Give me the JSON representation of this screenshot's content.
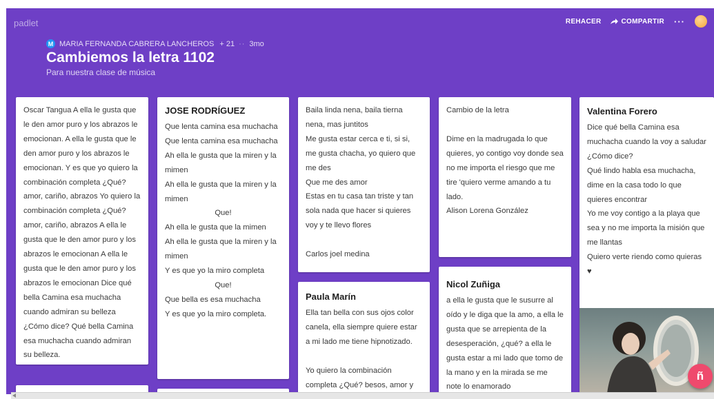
{
  "app": {
    "logo": "padlet"
  },
  "header": {
    "author_initial": "M",
    "author": "MARIA FERNANDA CABRERA LANCHEROS",
    "plus": "+ 21",
    "age": "3mo",
    "title": "Cambiemos la letra 1102",
    "subtitle": "Para nuestra clase de música"
  },
  "toolbar": {
    "redo": "REHACER",
    "share": "COMPARTIR",
    "more": "···"
  },
  "posts": {
    "oscar": {
      "body": "Oscar Tangua A ella le gusta que le den amor puro y los abrazos le emocionan. A ella le gusta que le den amor puro y los abrazos le emocionan. Y es que yo quiero la combinación completa ¿Qué? amor, cariño, abrazos Yo quiero la combinación completa ¿Qué? amor, cariño, abrazos A ella le gusta que le den amor puro y los abrazos le emocionan A ella le gusta que le den amor puro y los abrazos le emocionan Dice qué bella Camina esa muchacha cuando admiran su belleza ¿Cómo dice? Qué bella Camina esa muchacha cuando admiran su belleza."
    },
    "jose": {
      "title": "JOSE RODRÍGUEZ",
      "lines1": "Que lenta camina esa muchacha\nQue lenta camina esa muchacha\nAh ella le gusta que la miren y la mimen\nAh ella le gusta que la miren y la mimen",
      "que1": "Que!",
      "lines2": "Ah ella le gusta que la mimen\nAh ella le gusta que la miren y la mimen\nY es que yo la miro completa",
      "que2": "Que!",
      "lines3": "Que bella es esa muchacha\nY es que yo la miro completa."
    },
    "carlos": {
      "body": "Baila linda nena, baila tierna nena, mas juntitos\nMe gusta estar cerca e ti, si si, me gusta chacha, yo quiero que me des\nQue me des amor\nEstas en tu casa tan triste y tan sola nada que hacer si quieres voy y te llevo flores",
      "signature": "Carlos joel medina"
    },
    "paula": {
      "title": "Paula Marín",
      "body1": "Ella tan bella con sus ojos color canela, ella siempre quiere estar a mi lado me tiene hipnotizado.",
      "body2": " Yo quiero la combinación completa ¿Qué? besos, amor y"
    },
    "alison": {
      "title": "Cambio de la letra",
      "body": "Dime en la madrugada lo que quieres, yo contigo voy donde sea no me importa el riesgo que me tire 'quiero verme amando a tu lado.\nAlison Lorena González"
    },
    "nicol": {
      "title": "Nicol Zuñiga",
      "body": "a ella le gusta que le susurre al oído y le diga que la amo, a ella le gusta que se arrepienta de la desesperación, ¿qué? a ella le gusta estar a mi lado que tomo de la mano y en la mirada se me note lo enamorado"
    },
    "valentina": {
      "title": "Valentina Forero",
      "body": "Dice qué bella Camina esa muchacha cuando la voy a saludar ¿Cómo dice?\nQué lindo habla esa muchacha, dime en la casa todo lo que quieres encontrar\nYo me voy contigo a la playa que sea y no me importa la misión que me llantas\nQuiero verte riendo como quieras ♥"
    }
  },
  "fab": {
    "glyph": "ñ"
  },
  "colors": {
    "board": "#6e3fc6",
    "fab": "#ef4a6d",
    "card": "#ffffff"
  },
  "icons": [
    "share-arrow-icon",
    "more-icon",
    "avatar",
    "mirror-photo"
  ]
}
